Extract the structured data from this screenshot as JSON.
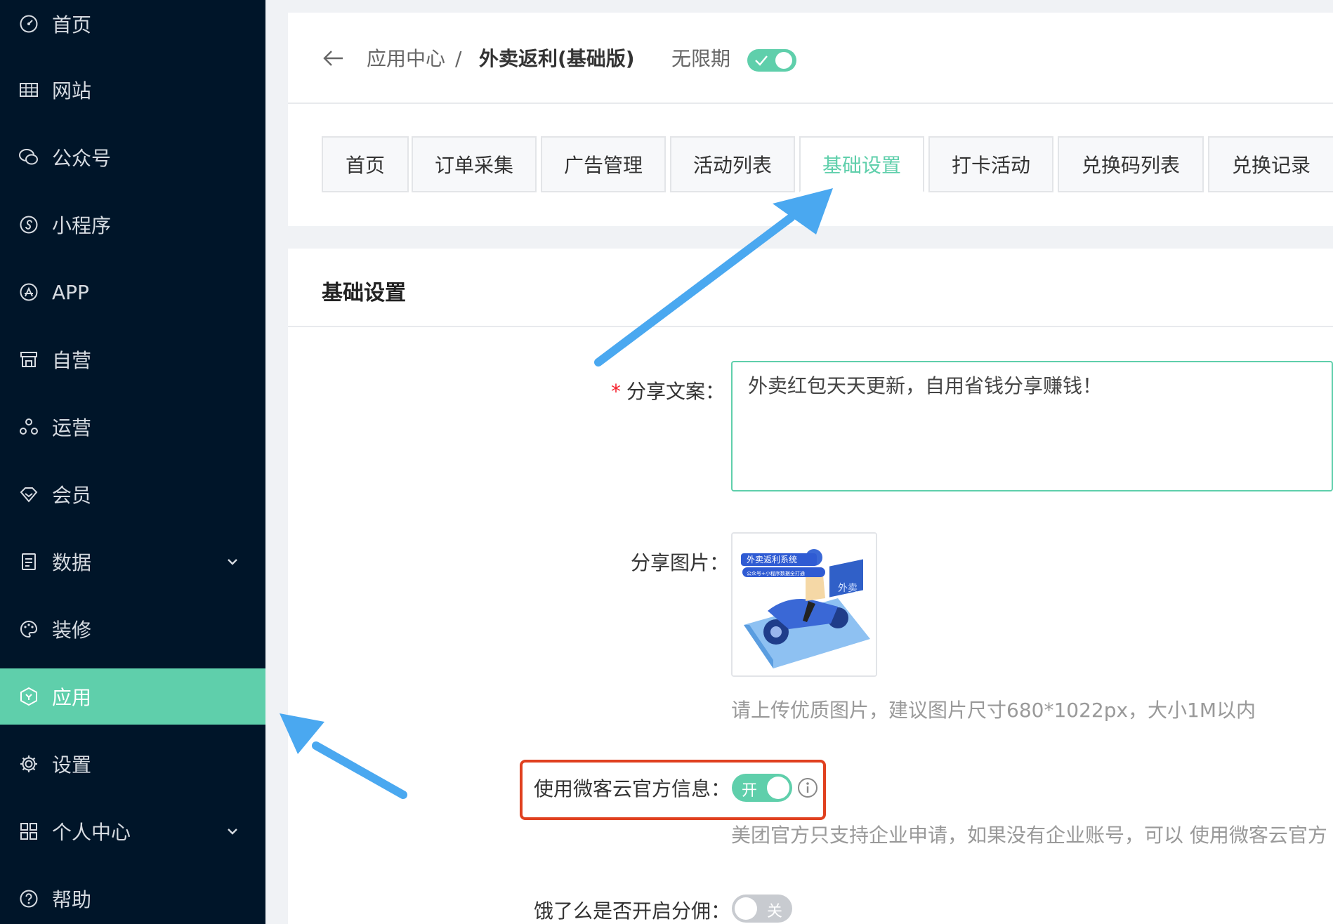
{
  "sidebar": {
    "items": [
      {
        "label": "首页",
        "icon": "dashboard-icon"
      },
      {
        "label": "网站",
        "icon": "grid-table-icon"
      },
      {
        "label": "公众号",
        "icon": "wechat-icon"
      },
      {
        "label": "小程序",
        "icon": "miniprogram-icon"
      },
      {
        "label": "APP",
        "icon": "app-store-icon"
      },
      {
        "label": "自营",
        "icon": "shop-icon"
      },
      {
        "label": "运营",
        "icon": "operations-icon"
      },
      {
        "label": "会员",
        "icon": "diamond-icon"
      },
      {
        "label": "数据",
        "icon": "clipboard-icon",
        "expandable": true
      },
      {
        "label": "装修",
        "icon": "palette-icon"
      },
      {
        "label": "应用",
        "icon": "hexagon-icon",
        "active": true
      },
      {
        "label": "设置",
        "icon": "gear-icon"
      },
      {
        "label": "个人中心",
        "icon": "apps-icon",
        "expandable": true
      },
      {
        "label": "帮助",
        "icon": "question-icon"
      }
    ]
  },
  "header": {
    "breadcrumb_parent": "应用中心",
    "breadcrumb_separator": "/",
    "breadcrumb_current": "外卖返利(基础版)",
    "validity_label": "无限期",
    "validity_toggle_on": true
  },
  "tabs": [
    {
      "label": "首页"
    },
    {
      "label": "订单采集"
    },
    {
      "label": "广告管理"
    },
    {
      "label": "活动列表"
    },
    {
      "label": "基础设置",
      "active": true
    },
    {
      "label": "打卡活动"
    },
    {
      "label": "兑换码列表"
    },
    {
      "label": "兑换记录"
    }
  ],
  "settings": {
    "section_title": "基础设置",
    "share_text": {
      "required_mark": "*",
      "label": "分享文案：",
      "value": "外卖红包天天更新，自用省钱分享赚钱！"
    },
    "share_image": {
      "label": "分享图片：",
      "image_title": "外卖返利系统",
      "image_subtitle": "公众号+小程序数据全打通",
      "box_text": "外卖",
      "hint": "请上传优质图片，建议图片尺寸680*1022px，大小1M以内"
    },
    "official_info": {
      "label": "使用微客云官方信息：",
      "toggle_text": "开",
      "toggle_on": true,
      "hint": "美团官方只支持企业申请，如果没有企业账号，可以 使用微客云官方"
    },
    "eleme_commission": {
      "label": "饿了么是否开启分佣：",
      "toggle_text": "关",
      "toggle_on": false
    }
  },
  "colors": {
    "sidebar_bg": "#001529",
    "accent": "#5fcfab",
    "highlight_box": "#e0401f",
    "annotation_arrow": "#4aa8f0"
  }
}
